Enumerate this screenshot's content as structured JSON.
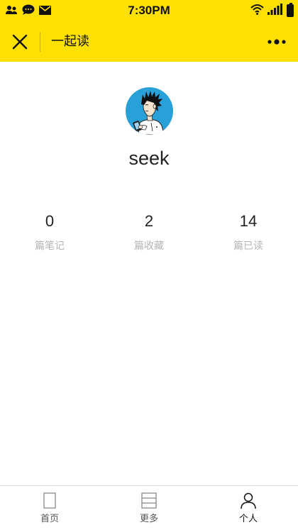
{
  "status_bar": {
    "time": "7:30PM",
    "left_icons": [
      "contacts-icon",
      "chat-bubble-icon",
      "mail-icon"
    ],
    "right_icons": [
      "wifi-icon",
      "signal-icon",
      "battery-icon"
    ]
  },
  "nav": {
    "title": "一起读",
    "close_icon": "close-icon",
    "more_icon": "more-dots-icon"
  },
  "profile": {
    "username": "seek",
    "avatar": "avatar-cartoon-boy-with-phone"
  },
  "stats": [
    {
      "value": "0",
      "label": "篇笔记"
    },
    {
      "value": "2",
      "label": "篇收藏"
    },
    {
      "value": "14",
      "label": "篇已读"
    }
  ],
  "tabs": [
    {
      "label": "首页",
      "icon": "page-icon",
      "active": false
    },
    {
      "label": "更多",
      "icon": "list-icon",
      "active": false
    },
    {
      "label": "个人",
      "icon": "person-icon",
      "active": true
    }
  ],
  "colors": {
    "accent": "#ffe000",
    "label_gray": "#b5b5b5",
    "avatar_bg": "#2aa0d8"
  }
}
